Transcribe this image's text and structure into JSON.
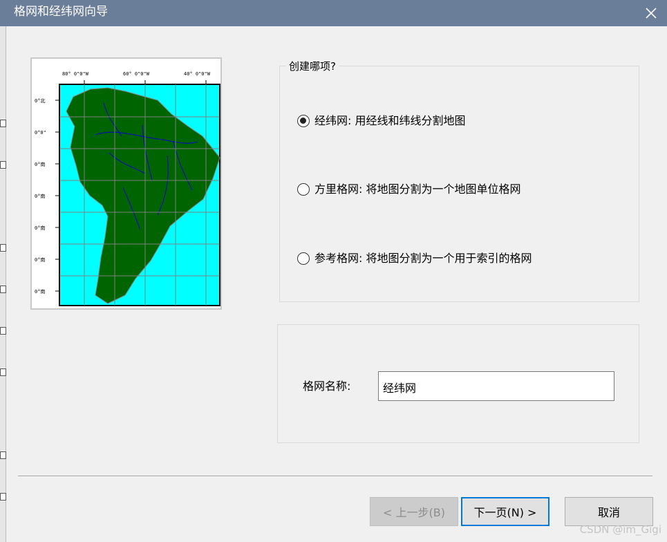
{
  "window": {
    "title": "格网和经纬网向导",
    "close_icon": "close-icon"
  },
  "preview": {
    "top_labels": [
      "80° 0\"0\"W",
      "60° 0\"0\"W",
      "40° 0\"0\"W"
    ],
    "side_labels": [
      "0°北",
      "0°0\"",
      "0°南",
      "0°南",
      "0°南",
      "0°南",
      "0°南"
    ],
    "colors": {
      "ocean": "#00ffff",
      "land": "#006400",
      "rivers": "#0000cc",
      "grid": "#808080",
      "frame": "#000000"
    }
  },
  "options_group": {
    "legend": "创建哪项?",
    "options": [
      {
        "label": "经纬网: 用经线和纬线分割地图",
        "checked": true
      },
      {
        "label": "方里格网: 将地图分割为一个地图单位格网",
        "checked": false
      },
      {
        "label": "参考格网: 将地图分割为一个用于索引的格网",
        "checked": false
      }
    ]
  },
  "name_group": {
    "label": "格网名称:",
    "value": "经纬网"
  },
  "buttons": {
    "back": "< 上一步(B)",
    "next": "下一页(N) >",
    "cancel": "取消"
  },
  "watermark": "CSDN @im_Gigi"
}
